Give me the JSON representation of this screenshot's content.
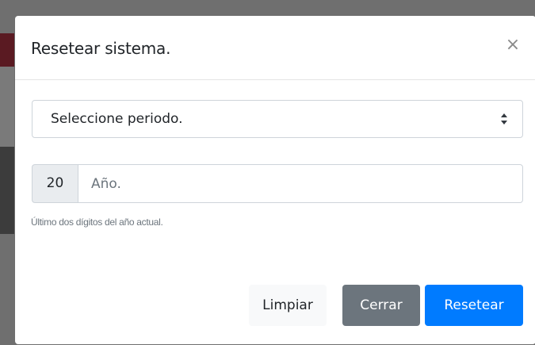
{
  "modal": {
    "title": "Resetear sistema.",
    "close_label": "×"
  },
  "period_select": {
    "selected": "Seleccione periodo."
  },
  "year_input": {
    "prefix": "20",
    "placeholder": "Año.",
    "value": "",
    "help_text": "Último dos dígitos del año actual."
  },
  "footer": {
    "clear_label": "Limpiar",
    "close_label": "Cerrar",
    "reset_label": "Resetear"
  },
  "colors": {
    "primary": "#007bff",
    "secondary": "#6c757d",
    "light": "#f8f9fa"
  }
}
